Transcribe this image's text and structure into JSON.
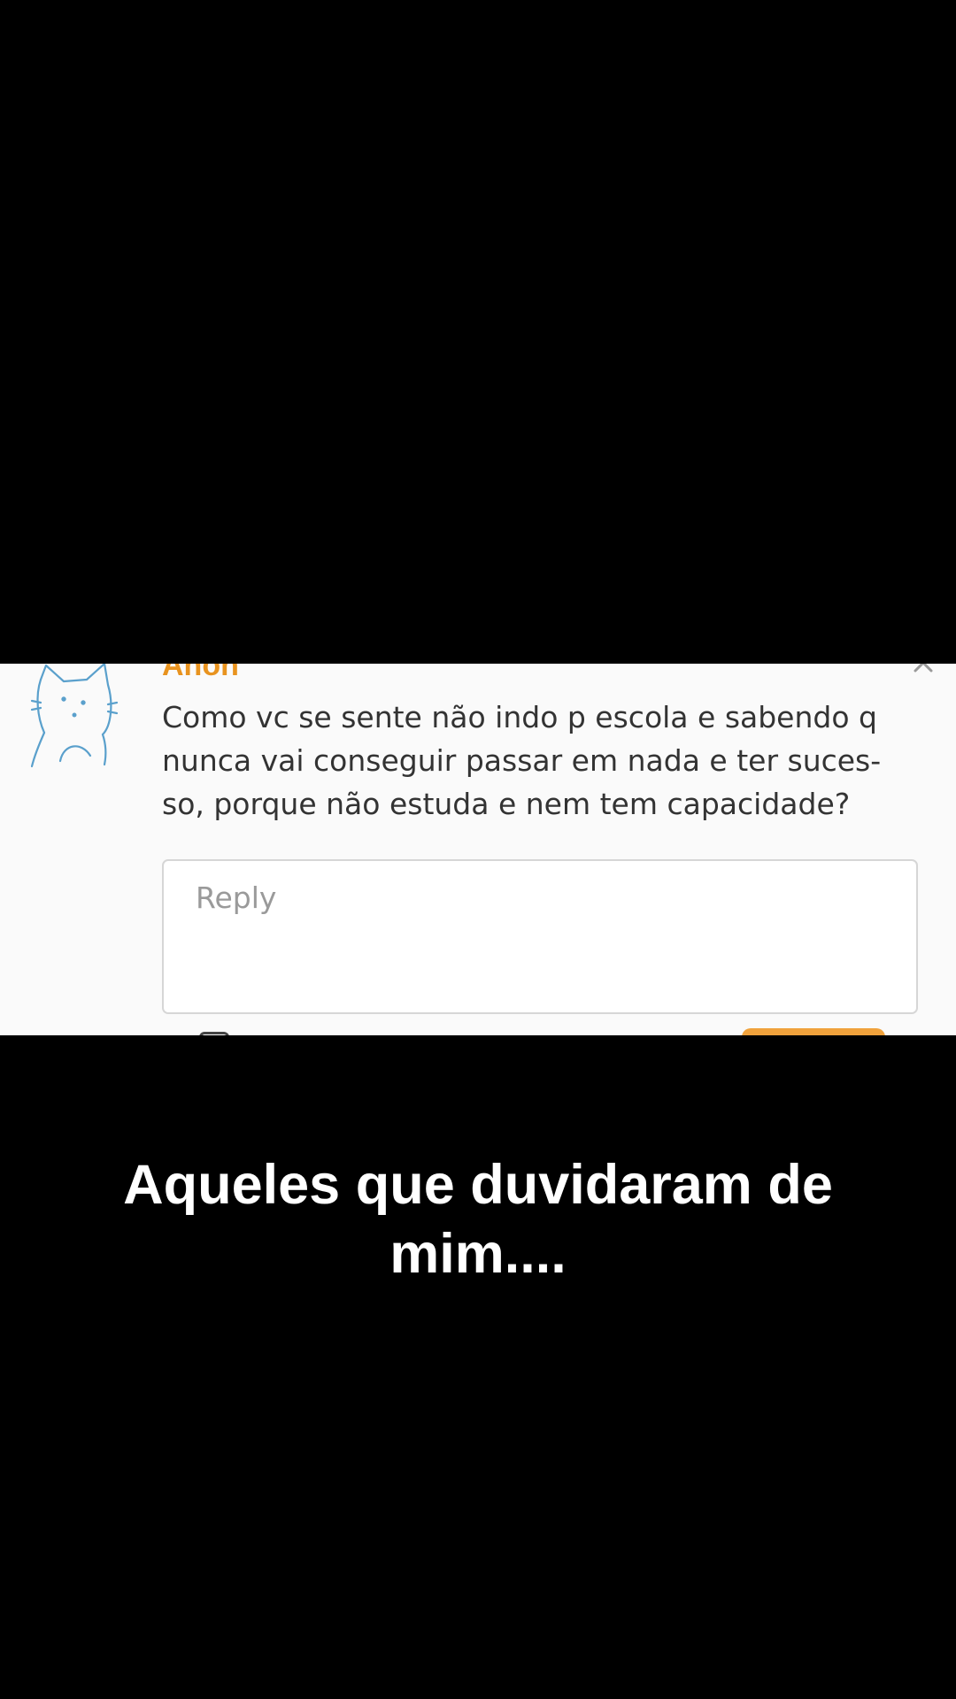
{
  "question_card": {
    "author": "Anon",
    "question_text": "Como vc se sente não indo p escola e sabendo q\nnunca vai conseguir passar em nada e ter suces-\nso, porque não estuda e nem tem capacidade?",
    "reply_placeholder": "Reply",
    "accent_color": "#e8931f",
    "avatar_icon": "cat-sketch-icon",
    "close_icon": "close-icon"
  },
  "overlay": {
    "caption": "Aqueles que duvidaram de\nmim...."
  }
}
